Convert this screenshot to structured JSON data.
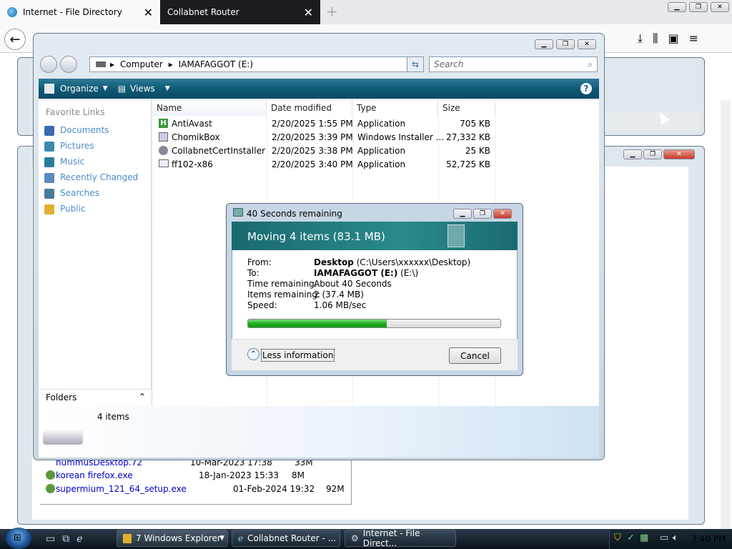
{
  "firefox": {
    "tabs": [
      {
        "label": "Internet - File Directory"
      },
      {
        "label": "Collabnet Router"
      }
    ],
    "new_tab": "+",
    "close": "✕"
  },
  "bg_files": [
    {
      "name": "hummusDesktop.72",
      "date": "10-Mar-2023 17:38",
      "size": "33M"
    },
    {
      "name": "korean firefox.exe",
      "date": "18-Jan-2023 15:33",
      "size": "8M"
    },
    {
      "name": "supermium_121_64_setup.exe",
      "date": "01-Feb-2024 19:32",
      "size": "92M"
    }
  ],
  "explorer": {
    "breadcrumb": [
      "Computer",
      "IAMAFAGGOT (E:)"
    ],
    "search_placeholder": "Search",
    "toolbar": {
      "organize": "Organize",
      "views": "Views"
    },
    "nav_heading": "Favorite Links",
    "nav_items": [
      {
        "label": "Documents",
        "color": "#3a6ab0"
      },
      {
        "label": "Pictures",
        "color": "#3a8ab0"
      },
      {
        "label": "Music",
        "color": "#2a7aa0"
      },
      {
        "label": "Recently Changed",
        "color": "#5a8ac0"
      },
      {
        "label": "Searches",
        "color": "#4a7a9a"
      },
      {
        "label": "Public",
        "color": "#e0b030"
      }
    ],
    "folders_label": "Folders",
    "columns": [
      "Name",
      "Date modified",
      "Type",
      "Size"
    ],
    "files": [
      {
        "name": "AntiAvast",
        "date": "2/20/2025 1:55 PM",
        "type": "Application",
        "size": "705 KB"
      },
      {
        "name": "ChomikBox",
        "date": "2/20/2025 3:39 PM",
        "type": "Windows Installer ...",
        "size": "27,332 KB"
      },
      {
        "name": "CollabnetCertInstaller",
        "date": "2/20/2025 3:38 PM",
        "type": "Application",
        "size": "25 KB"
      },
      {
        "name": "ff102-x86",
        "date": "2/20/2025 3:40 PM",
        "type": "Application",
        "size": "52,725 KB"
      }
    ],
    "status": "4 items"
  },
  "dialog": {
    "title": "40 Seconds remaining",
    "heading": "Moving 4 items (83.1 MB)",
    "rows": [
      {
        "label": "From:",
        "bold": "Desktop",
        "rest": " (C:\\Users\\xxxxxx\\Desktop)"
      },
      {
        "label": "To:",
        "bold": "IAMAFAGGOT (E:)",
        "rest": " (E:\\)"
      },
      {
        "label": "Time remaining:",
        "bold": "",
        "rest": "About 40 Seconds"
      },
      {
        "label": "Items remaining:",
        "bold": "",
        "rest": "2 (37.4 MB)"
      },
      {
        "label": "Speed:",
        "bold": "",
        "rest": "1.06 MB/sec"
      }
    ],
    "progress": 0.55,
    "less_info": "Less information",
    "cancel": "Cancel"
  },
  "taskbar": {
    "items": [
      {
        "label": "7 Windows Explorer"
      },
      {
        "label": "Collabnet Router - ..."
      },
      {
        "label": "Internet - File Direct..."
      }
    ],
    "clock": "3:40 PM"
  }
}
